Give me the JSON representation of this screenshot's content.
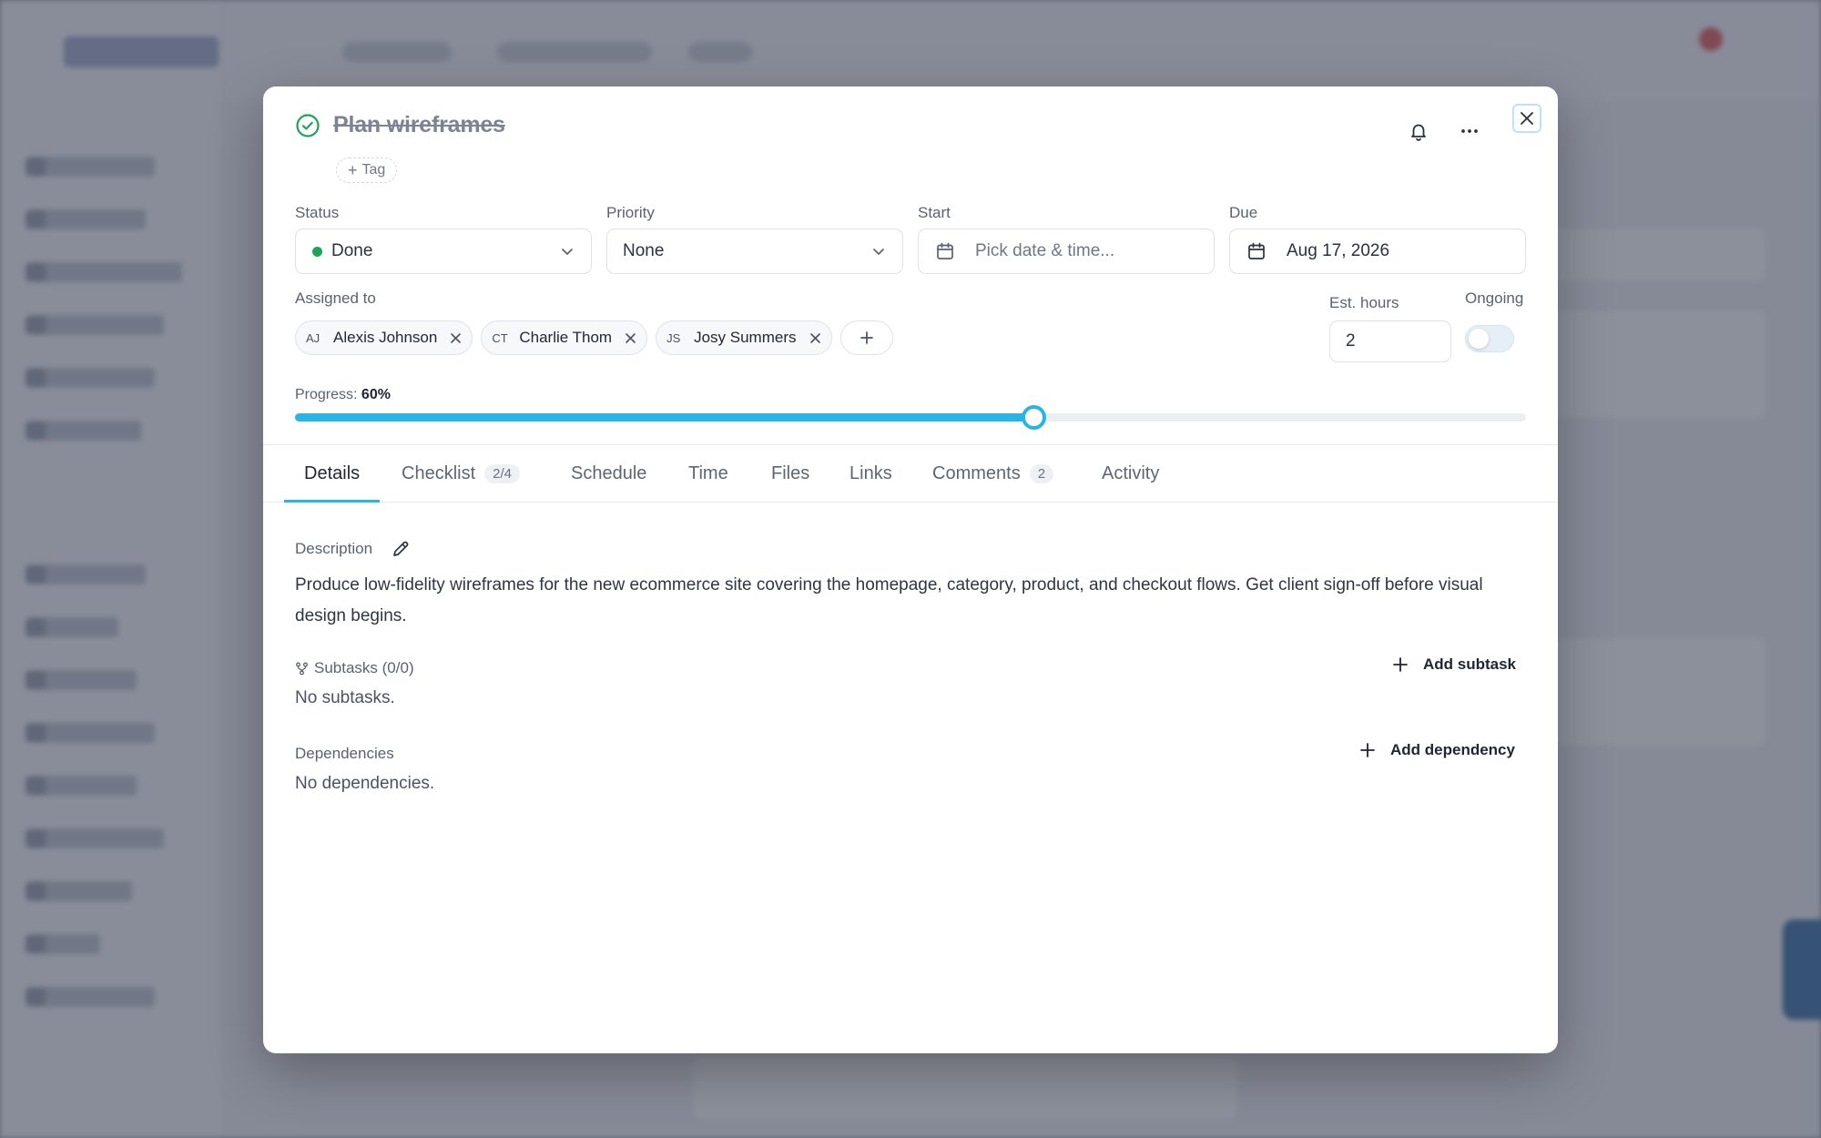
{
  "task": {
    "title": "Plan wireframes",
    "tag_button": "Tag"
  },
  "fields": {
    "status_label": "Status",
    "status_value": "Done",
    "status_color": "#1fa35b",
    "priority_label": "Priority",
    "priority_value": "None",
    "start_label": "Start",
    "start_placeholder": "Pick date & time...",
    "due_label": "Due",
    "due_value": "Aug 17, 2026"
  },
  "assigned": {
    "label": "Assigned to",
    "people": [
      {
        "initials": "AJ",
        "name": "Alexis Johnson"
      },
      {
        "initials": "CT",
        "name": "Charlie Thom"
      },
      {
        "initials": "JS",
        "name": "Josy Summers"
      }
    ]
  },
  "estimate": {
    "label": "Est. hours",
    "value": "2",
    "ongoing_label": "Ongoing",
    "ongoing_on": false
  },
  "progress": {
    "label": "Progress:",
    "value_text": "60%",
    "percent": 60,
    "accent": "#28b5e6"
  },
  "tabs": [
    {
      "label": "Details",
      "badge": ""
    },
    {
      "label": "Checklist",
      "badge": "2/4"
    },
    {
      "label": "Schedule",
      "badge": ""
    },
    {
      "label": "Time",
      "badge": ""
    },
    {
      "label": "Files",
      "badge": ""
    },
    {
      "label": "Links",
      "badge": ""
    },
    {
      "label": "Comments",
      "badge": "2"
    },
    {
      "label": "Activity",
      "badge": ""
    }
  ],
  "active_tab": "Details",
  "details": {
    "description_label": "Description",
    "description": "Produce low-fidelity wireframes for the new ecommerce site covering the homepage, category, product, and checkout flows. Get client sign-off before visual design begins.",
    "subtasks_label": "Subtasks (0/0)",
    "subtasks_empty": "No subtasks.",
    "add_subtask": "Add subtask",
    "dependencies_label": "Dependencies",
    "dependencies_empty": "No dependencies.",
    "add_dependency": "Add dependency"
  },
  "icons": [
    "check-circle-icon",
    "bell-icon",
    "more-icon",
    "close-icon",
    "chevron-down-icon",
    "calendar-icon",
    "plus-icon",
    "x-icon",
    "pencil-icon",
    "subtask-icon"
  ]
}
